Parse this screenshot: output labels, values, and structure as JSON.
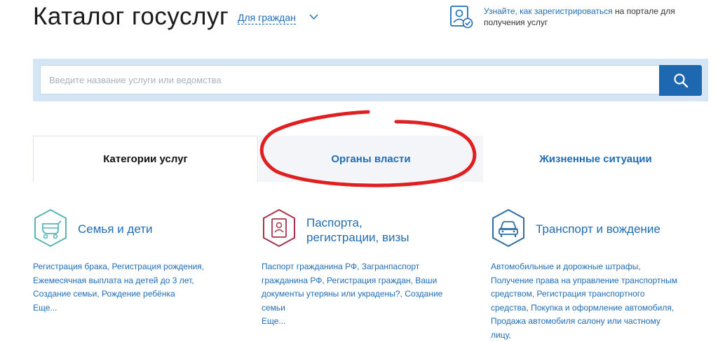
{
  "header": {
    "title": "Каталог госуслуг",
    "audience": "Для граждан",
    "register_link": "Узнайте, как зарегистрироваться",
    "register_rest": " на портале для получения услуг"
  },
  "search": {
    "placeholder": "Введите название услуги или ведомства"
  },
  "tabs": [
    {
      "label": "Категории услуг"
    },
    {
      "label": "Органы власти"
    },
    {
      "label": "Жизненные ситуации"
    }
  ],
  "categories": [
    {
      "title": "Семья и дети",
      "icon": "stroller-icon",
      "links": "Регистрация брака, Регистрация рождения, Ежемесячная выплата на детей до 3 лет, Создание семьи, Рождение ребёнка",
      "more": "Еще..."
    },
    {
      "title_line1": "Паспорта,",
      "title_line2": "регистрации, визы",
      "icon": "passport-icon",
      "links": "Паспорт гражданина РФ, Загранпаспорт гражданина РФ, Регистрация граждан, Ваши документы утеряны или украдены?, Создание семьи",
      "more": "Еще..."
    },
    {
      "title": "Транспорт и вождение",
      "icon": "car-icon",
      "links": "Автомобильные и дорожные штрафы, Получение права на управление транспортным средством, Регистрация транспортного средства, Покупка и оформление автомобиля, Продажа автомобиля салону или частному лицу,"
    }
  ],
  "colors": {
    "link": "#1f6db5",
    "search_band": "#d4e6f6",
    "search_button": "#1e67b1",
    "annotation": "#e02020"
  }
}
